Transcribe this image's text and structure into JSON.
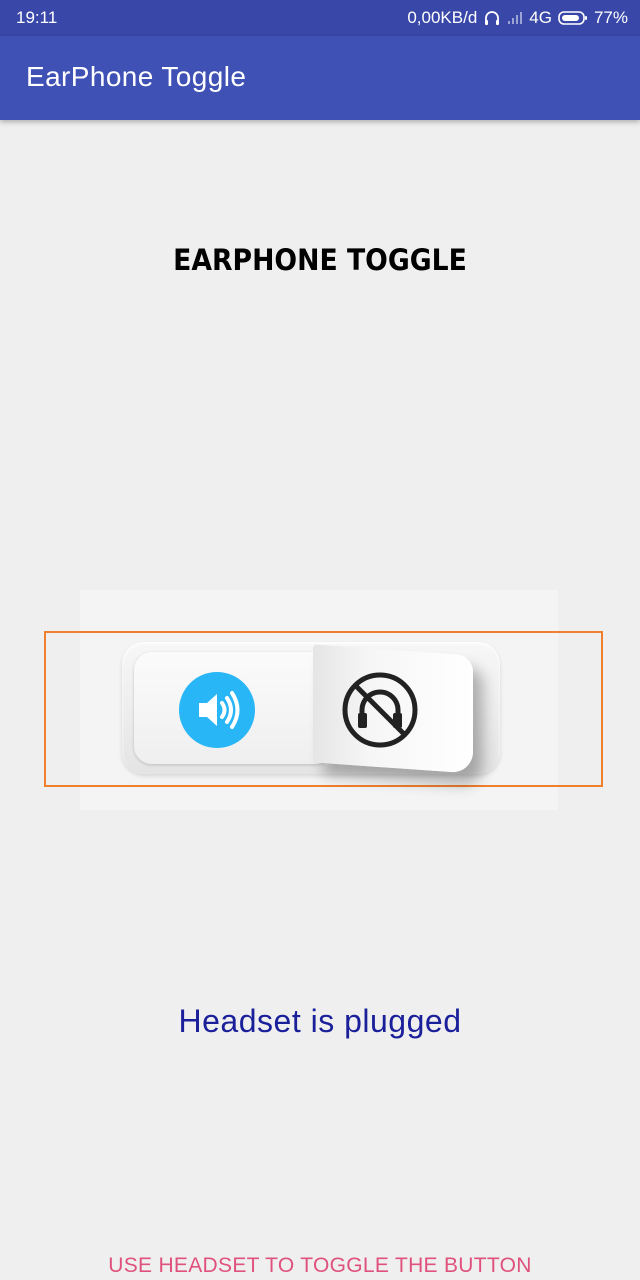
{
  "status_bar": {
    "time": "19:11",
    "network_speed": "0,00KB/d",
    "network_type": "4G",
    "battery_percent": "77%",
    "icons": [
      "headset-icon",
      "signal-icon",
      "battery-icon"
    ]
  },
  "app_bar": {
    "title": "EarPhone Toggle"
  },
  "main": {
    "heading": "EARPHONE TOGGLE",
    "toggle": {
      "left_icon": "speaker-icon",
      "right_icon": "no-headset-icon",
      "accent_color": "#29b6f6",
      "outline_color": "#f07f2e"
    },
    "status_message": "Headset is plugged",
    "hint": "USE HEADSET TO TOGGLE THE BUTTON"
  },
  "colors": {
    "primary": "#3f51b5",
    "primary_dark": "#3948a8",
    "status_text": "#1a1f9a",
    "hint_text": "#e0527e"
  }
}
